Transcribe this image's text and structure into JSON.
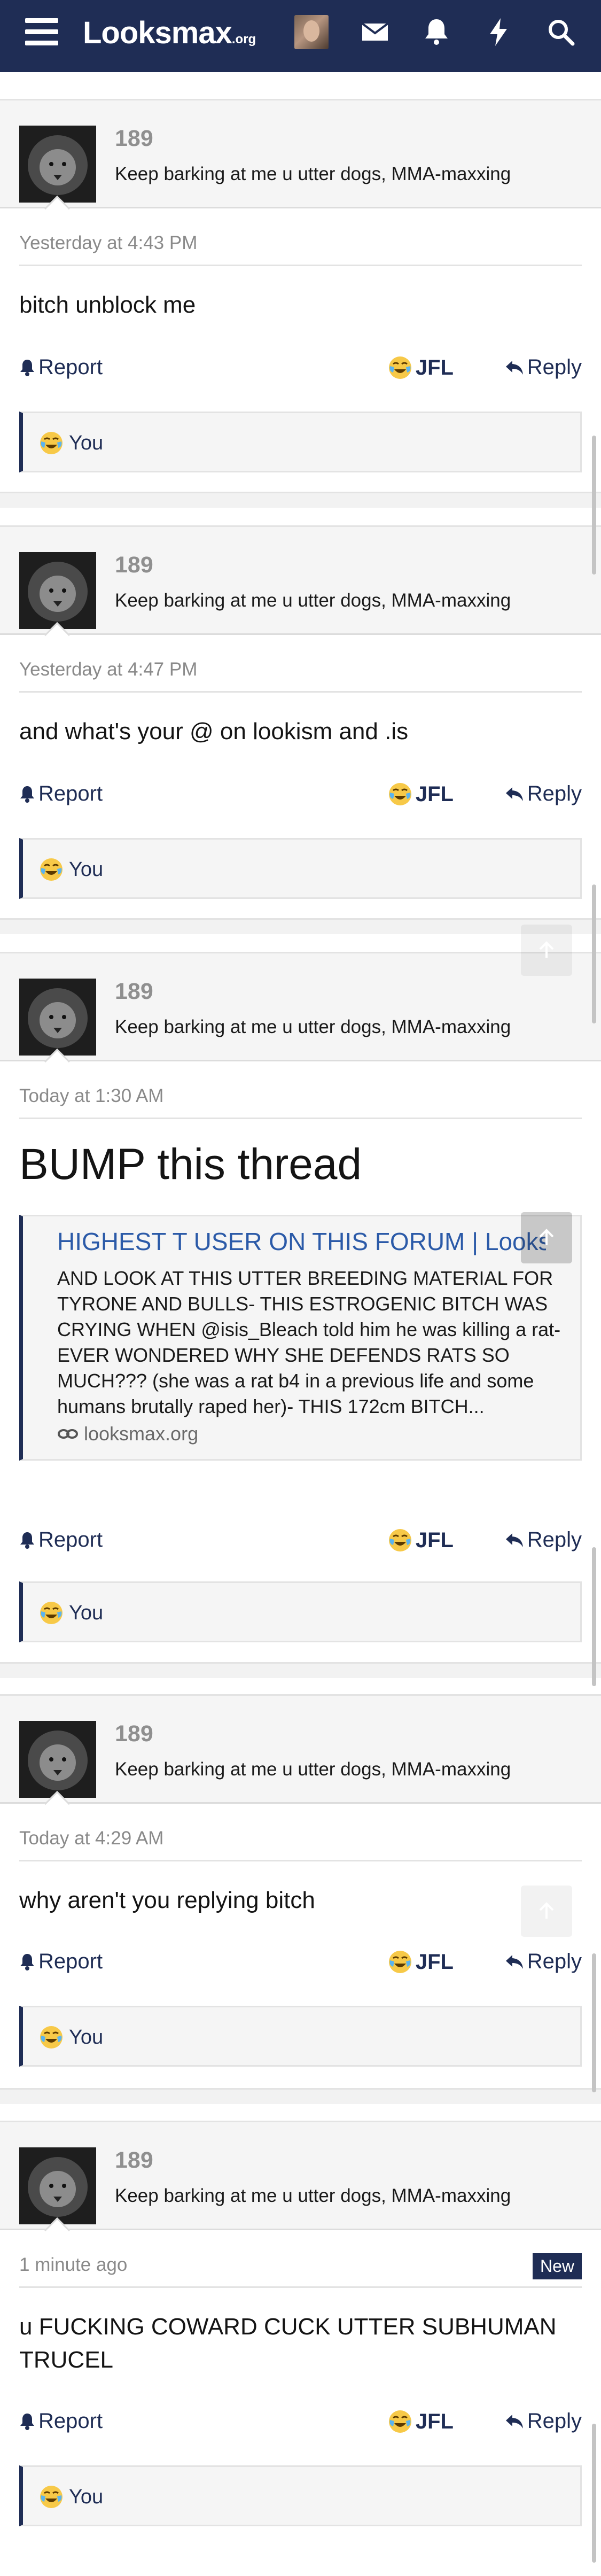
{
  "header": {
    "logo_main": "Looksmax",
    "logo_suffix": ".org",
    "icons": [
      "menu-icon",
      "avatar",
      "mail-icon",
      "bell-icon",
      "bolt-icon",
      "search-icon"
    ],
    "accent_color": "#1f2d55"
  },
  "posts": [
    {
      "username": "189",
      "user_title": "Keep barking at me u utter dogs, MMA-maxxing",
      "date": "Yesterday at 4:43 PM",
      "message": "bitch unblock me",
      "report_label": "Report",
      "reaction_label": "JFL",
      "reply_label": "Reply",
      "reacted_by": "You"
    },
    {
      "username": "189",
      "user_title": "Keep barking at me u utter dogs, MMA-maxxing",
      "date": "Yesterday at 4:47 PM",
      "message": "and what's your @ on lookism and .is",
      "report_label": "Report",
      "reaction_label": "JFL",
      "reply_label": "Reply",
      "reacted_by": "You"
    },
    {
      "username": "189",
      "user_title": "Keep barking at me u utter dogs, MMA-maxxing",
      "date": "Today at 1:30 AM",
      "message": "BUMP this thread",
      "quote": {
        "title": "HIGHEST T USER ON THIS FORUM | Looks...",
        "body": "AND LOOK AT THIS UTTER BREEDING MATERIAL FOR TYRONE AND BULLS- THIS ESTROGENIC BITCH WAS CRYING WHEN @isis_Bleach told him he was killing a rat- EVER WONDERED WHY SHE DEFENDS RATS SO MUCH??? (she was a rat b4 in a previous life and some humans brutally raped her)- THIS 172cm BITCH...",
        "link": "looksmax.org"
      },
      "report_label": "Report",
      "reaction_label": "JFL",
      "reply_label": "Reply",
      "reacted_by": "You"
    },
    {
      "username": "189",
      "user_title": "Keep barking at me u utter dogs, MMA-maxxing",
      "date": "Today at 4:29 AM",
      "message": "why aren't you replying bitch",
      "report_label": "Report",
      "reaction_label": "JFL",
      "reply_label": "Reply",
      "reacted_by": "You"
    },
    {
      "username": "189",
      "user_title": "Keep barking at me u utter dogs, MMA-maxxing",
      "date": "1 minute ago",
      "badge": "New",
      "message": "u FUCKING COWARD CUCK UTTER SUBHUMAN TRUCEL",
      "report_label": "Report",
      "reaction_label": "JFL",
      "reply_label": "Reply",
      "reacted_by": "You"
    }
  ]
}
